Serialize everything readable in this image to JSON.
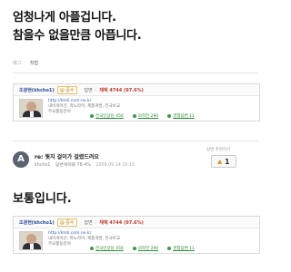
{
  "question": {
    "line1": "엄청나게 아플겁니다.",
    "line2": "참을수 없을만큼 아픕니다."
  },
  "tags": {
    "label": "태그",
    "value": "직접"
  },
  "profile": {
    "name": "조광현(khcho1)",
    "grade": "@ 중수",
    "answers_label": "답변",
    "answer_count": "채택 4744 (97.6%)",
    "info_line1": "http://khdi.com.ne.kr",
    "info_line2": "내비게이션, 파노라마, 제품개발, 전국비교",
    "info_line3": "주요활동분야",
    "stats": [
      "전국인상당 456",
      "의학전 290",
      "경험답변 11"
    ]
  },
  "answer": {
    "badge": "A",
    "title": "re: 뭣지 걸이가 걸렸드려요",
    "author": "khcho1",
    "adoption": "답변채택률 78.4%",
    "date": "2009.09.14 10:15",
    "rec_label": "답변 추천하기",
    "rec_count": "1",
    "text": "보통입니다."
  },
  "profile2": {
    "name": "조광현(khcho1)",
    "grade": "@ 중수",
    "answers_label": "답변",
    "answer_count": "채택 4744 (97.6%)",
    "info_line1": "http://khdi.com.ne.kr",
    "info_line2": "내비게이션, 파노라마, 제품개발, 전국비교",
    "info_line3": "주요활동분야",
    "stats": [
      "전국인상당 456",
      "의학전 290",
      "경험답변 11"
    ]
  }
}
